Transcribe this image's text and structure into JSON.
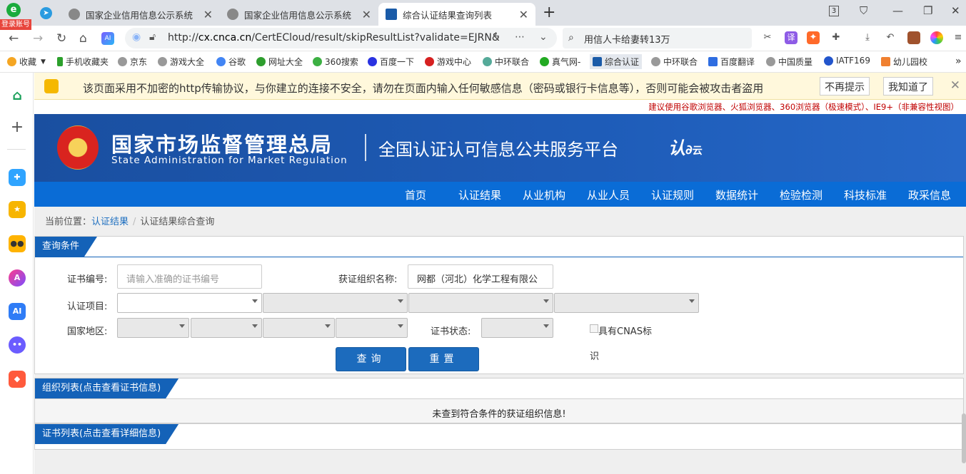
{
  "browser": {
    "tabs": [
      {
        "title": "国家企业信用信息公示系统"
      },
      {
        "title": "国家企业信用信息公示系统"
      },
      {
        "title": "综合认证结果查询列表"
      }
    ],
    "login_badge": "登录账号",
    "tab_count": "3",
    "url_prefix": "http://",
    "url_domain": "cx.cnca.cn",
    "url_path": "/CertECloud/result/skipResultList?validate=EJRN&",
    "search_text": "用信人卡给妻转13万",
    "bookmarks": [
      "收藏",
      "手机收藏夹",
      "京东",
      "游戏大全",
      "谷歌",
      "网址大全",
      "360搜索",
      "百度一下",
      "游戏中心",
      "中环联合",
      "真气网-",
      "综合认证",
      "中环联合",
      "百度翻译",
      "中国质量",
      "IATF169",
      "幼儿园校"
    ],
    "ext_translate": "译",
    "ext_ai": "AI",
    "sidebar_ai": "AI"
  },
  "warning": {
    "text": "该页面采用不加密的http传输协议，与你建立的连接不安全，请勿在页面内输入任何敏感信息（密码或银行卡信息等），否则可能会被攻击者盗用",
    "no_remind": "不再提示",
    "got_it": "我知道了"
  },
  "site": {
    "browser_hint": "建议使用谷歌浏览器、火狐浏览器、360浏览器（极速模式）、IE9+（非兼容性视图）",
    "brand_cn": "国家市场监督管理总局",
    "brand_en": "State Administration  for  Market Regulation",
    "platform": "全国认证认可信息公共服务平台",
    "logo_a": "认",
    "logo_b": "云",
    "nav": [
      "首页",
      "认证结果",
      "从业机构",
      "从业人员",
      "认证规则",
      "数据统计",
      "检验检测",
      "科技标准",
      "政采信息"
    ],
    "breadcrumb_label": "当前位置：",
    "breadcrumb_link": "认证结果",
    "breadcrumb_sep": "/",
    "breadcrumb_current": "认证结果综合查询"
  },
  "query": {
    "title": "查询条件",
    "cert_no_label": "证书编号:",
    "cert_no_placeholder": "请输入准确的证书编号",
    "org_label": "获证组织名称:",
    "org_value": "网都（河北）化学工程有限公",
    "project_label": "认证项目:",
    "region_label": "国家地区:",
    "status_label": "证书状态:",
    "cnas_label_1": "具有CNAS标",
    "cnas_label_2": "识",
    "search_btn": "查询",
    "reset_btn": "重置"
  },
  "org_list": {
    "title": "组织列表(点击查看证书信息)",
    "empty": "未查到符合条件的获证组织信息!"
  },
  "cert_list": {
    "title": "证书列表(点击查看详细信息)"
  }
}
